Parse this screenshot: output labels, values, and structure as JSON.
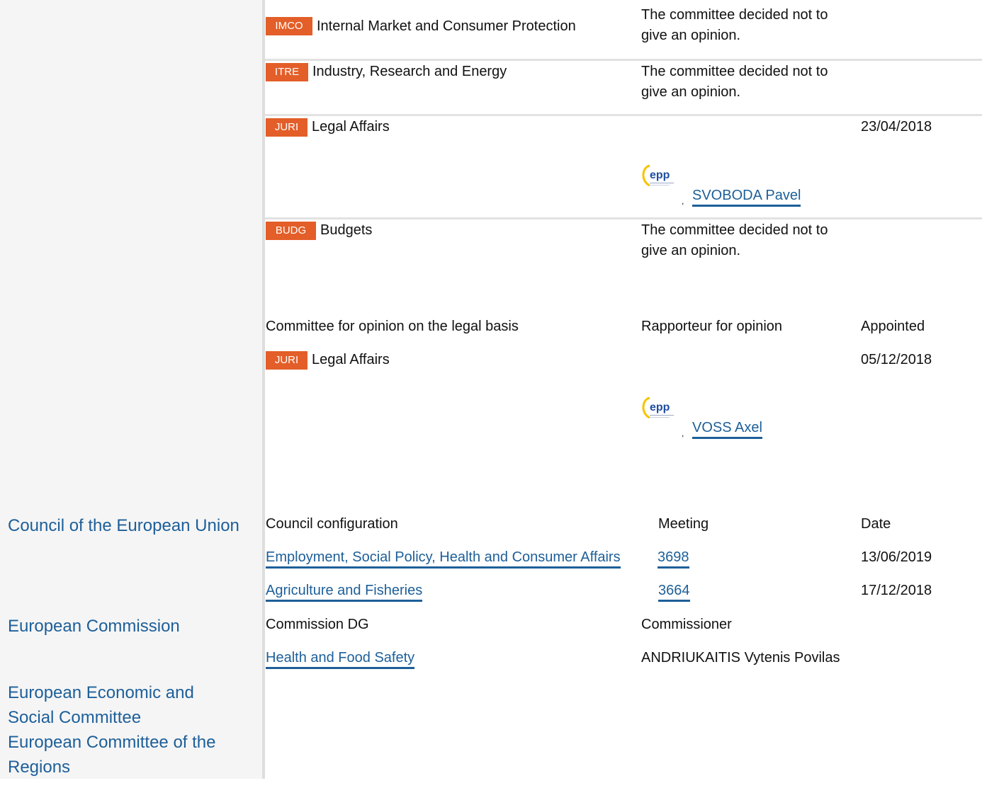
{
  "opinion_rows": [
    {
      "code": "IMCO",
      "name": "Internal Market and Consumer Protection",
      "note": "The committee decided not to give an opinion."
    },
    {
      "code": "ITRE",
      "name": "Industry, Research and Energy",
      "note": "The committee decided not to give an opinion."
    },
    {
      "code": "JURI",
      "name": "Legal Affairs",
      "rapporteur": "SVOBODA Pavel",
      "date": "23/04/2018"
    },
    {
      "code": "BUDG",
      "name": "Budgets",
      "note": "The committee decided not to give an opinion."
    }
  ],
  "legal_basis": {
    "headers": {
      "committee": "Committee for opinion on the legal basis",
      "rapporteur": "Rapporteur for opinion",
      "appointed": "Appointed"
    },
    "row": {
      "code": "JURI",
      "name": "Legal Affairs",
      "rapporteur": "VOSS Axel",
      "date": "05/12/2018"
    }
  },
  "council": {
    "title": "Council of the European Union",
    "headers": {
      "configuration": "Council configuration",
      "meeting": "Meeting",
      "date": "Date"
    },
    "rows": [
      {
        "configuration": "Employment, Social Policy, Health and Consumer Affairs",
        "meeting": "3698",
        "date": "13/06/2019"
      },
      {
        "configuration": "Agriculture and Fisheries",
        "meeting": "3664",
        "date": "17/12/2018"
      }
    ]
  },
  "commission": {
    "title": "European Commission",
    "headers": {
      "dg": "Commission DG",
      "commissioner": "Commissioner"
    },
    "row": {
      "dg": "Health and Food Safety",
      "commissioner": "ANDRIUKAITIS Vytenis Povilas"
    }
  },
  "other_institutions": [
    "European Economic and Social Committee",
    "European Committee of the Regions"
  ],
  "party_logo": {
    "text": "epp",
    "icon": "epp-group-logo",
    "color": "#1e4ea0",
    "accent": "#f6c400"
  },
  "colors": {
    "badge": "#e35e28",
    "link": "#1d5f99"
  }
}
